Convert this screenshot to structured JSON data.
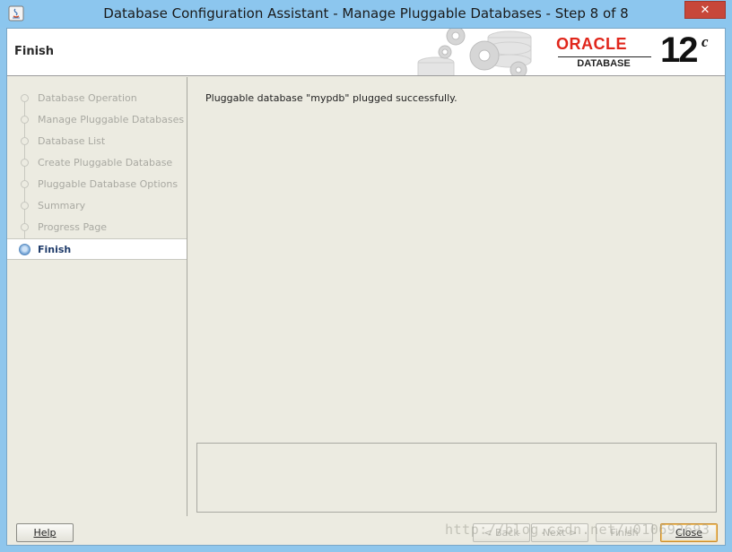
{
  "window": {
    "title": "Database Configuration Assistant - Manage Pluggable Databases - Step 8 of 8",
    "close_glyph": "✕"
  },
  "banner": {
    "title": "Finish",
    "logo_text": "ORACLE",
    "logo_subtext": "DATABASE",
    "version": "12",
    "version_suffix": "c",
    "brand_color": "#e0261b"
  },
  "steps": [
    {
      "label": "Database Operation",
      "active": false
    },
    {
      "label": "Manage Pluggable Databases",
      "active": false
    },
    {
      "label": "Database List",
      "active": false
    },
    {
      "label": "Create Pluggable Database",
      "active": false
    },
    {
      "label": "Pluggable Database Options",
      "active": false
    },
    {
      "label": "Summary",
      "active": false
    },
    {
      "label": "Progress Page",
      "active": false
    },
    {
      "label": "Finish",
      "active": true
    }
  ],
  "content": {
    "message": "Pluggable database \"mypdb\" plugged successfully.",
    "details": ""
  },
  "buttons": {
    "help": "Help",
    "back": "< Back",
    "next": "Next >",
    "finish": "Finish",
    "close": "Close"
  },
  "watermark": "http://blog.csdn.net/u010692693"
}
